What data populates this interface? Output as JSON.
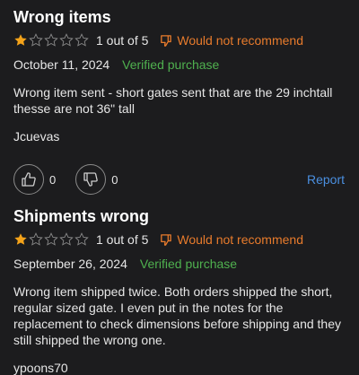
{
  "reviews": [
    {
      "title": "Wrong items",
      "rating": 1,
      "rating_max": 5,
      "rating_text": "1 out of 5",
      "recommend_text": "Would not recommend",
      "date": "October 11, 2024",
      "verified": "Verified purchase",
      "body": "Wrong item sent - short gates sent that are the 29 inchtall thesse are not 36\" tall",
      "author": "Jcuevas",
      "helpful_count": "0",
      "unhelpful_count": "0",
      "report_label": "Report"
    },
    {
      "title": "Shipments wrong",
      "rating": 1,
      "rating_max": 5,
      "rating_text": "1 out of 5",
      "recommend_text": "Would not recommend",
      "date": "September 26, 2024",
      "verified": "Verified purchase",
      "body": "Wrong item shipped twice. Both orders shipped the short, regular sized gate. I even put in the notes for the replacement to check dimensions before shipping and they still shipped the wrong one.",
      "author": "ypoons70"
    }
  ],
  "colors": {
    "star_filled": "#f4a31a",
    "star_empty": "#8a8a8a",
    "not_recommend": "#e87b2c",
    "verified": "#4fb14f",
    "link": "#4a8fe0"
  },
  "icons": {
    "recommend": "thumbs-down-outline-icon",
    "helpful": "thumbs-up-icon",
    "unhelpful": "thumbs-down-icon"
  }
}
